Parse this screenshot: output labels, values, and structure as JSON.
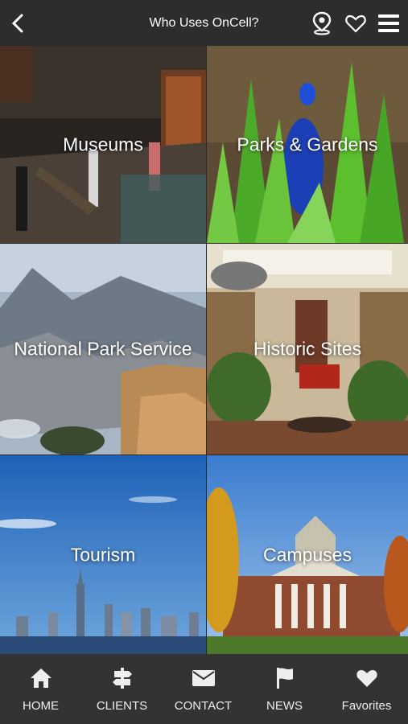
{
  "header": {
    "title": "Who Uses OnCell?",
    "back_icon": "chevron-left-icon",
    "location_icon": "map-pin-icon",
    "favorite_icon": "heart-outline-icon",
    "menu_icon": "hamburger-menu-icon"
  },
  "tiles": [
    {
      "label": "Museums"
    },
    {
      "label": "Parks & Gardens"
    },
    {
      "label": "National Park Service"
    },
    {
      "label": "Historic Sites"
    },
    {
      "label": "Tourism"
    },
    {
      "label": "Campuses"
    }
  ],
  "tabs": [
    {
      "label": "HOME",
      "icon": "home-icon"
    },
    {
      "label": "CLIENTS",
      "icon": "signpost-icon"
    },
    {
      "label": "CONTACT",
      "icon": "envelope-icon"
    },
    {
      "label": "NEWS",
      "icon": "flag-icon"
    },
    {
      "label": "Favorites",
      "icon": "heart-icon"
    }
  ]
}
